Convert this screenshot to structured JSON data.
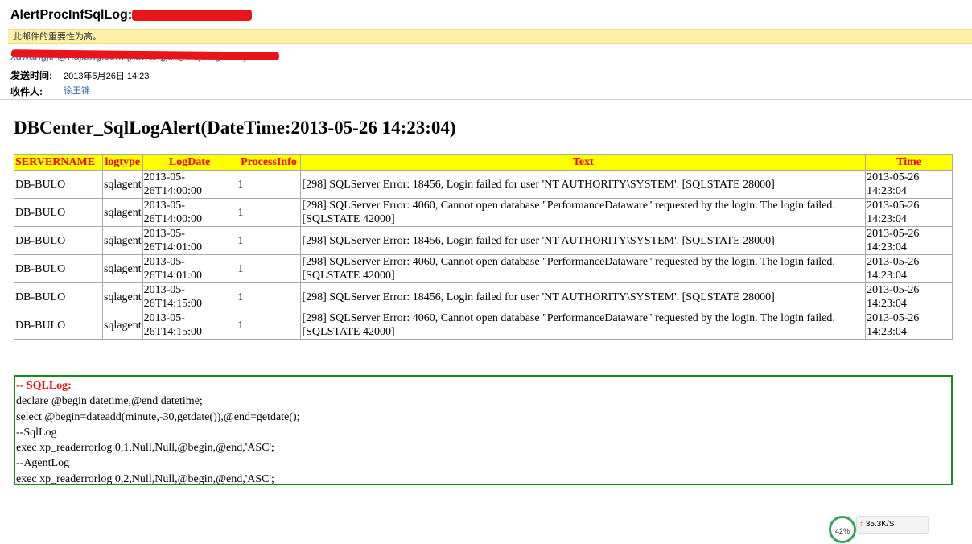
{
  "email": {
    "subject": "AlertProcInfSqlLog:",
    "importance_note": "此邮件的重要性为高。",
    "sender": "xuwangjin@hujiang.com [xuwangjin@hujiang.com]",
    "sent_label": "发送时间:",
    "sent_value": "2013年5月26日  14:23",
    "to_label": "收件人:",
    "to_value": "徐王锦"
  },
  "report": {
    "heading": "DBCenter_SqlLogAlert(DateTime:2013-05-26 14:23:04)",
    "columns": [
      "SERVERNAME",
      "logtype",
      "LogDate",
      "ProcessInfo",
      "Text",
      "Time"
    ],
    "rows": [
      [
        "DB-BULO",
        "sqlagent",
        "2013-05-26T14:00:00",
        "1",
        "[298] SQLServer Error: 18456, Login failed for user 'NT AUTHORITY\\SYSTEM'. [SQLSTATE 28000]",
        "2013-05-26 14:23:04"
      ],
      [
        "DB-BULO",
        "sqlagent",
        "2013-05-26T14:00:00",
        "1",
        "[298] SQLServer Error: 4060, Cannot open database \"PerformanceDataware\" requested by the login. The login failed. [SQLSTATE 42000]",
        "2013-05-26 14:23:04"
      ],
      [
        "DB-BULO",
        "sqlagent",
        "2013-05-26T14:01:00",
        "1",
        "[298] SQLServer Error: 18456, Login failed for user 'NT AUTHORITY\\SYSTEM'. [SQLSTATE 28000]",
        "2013-05-26 14:23:04"
      ],
      [
        "DB-BULO",
        "sqlagent",
        "2013-05-26T14:01:00",
        "1",
        "[298] SQLServer Error: 4060, Cannot open database \"PerformanceDataware\" requested by the login. The login failed. [SQLSTATE 42000]",
        "2013-05-26 14:23:04"
      ],
      [
        "DB-BULO",
        "sqlagent",
        "2013-05-26T14:15:00",
        "1",
        "[298] SQLServer Error: 18456, Login failed for user 'NT AUTHORITY\\SYSTEM'. [SQLSTATE 28000]",
        "2013-05-26 14:23:04"
      ],
      [
        "DB-BULO",
        "sqlagent",
        "2013-05-26T14:15:00",
        "1",
        "[298] SQLServer Error: 4060, Cannot open database \"PerformanceDataware\" requested by the login. The login failed. [SQLSTATE 42000]",
        "2013-05-26 14:23:04"
      ]
    ]
  },
  "sql": {
    "title": "-- SQLLog:",
    "lines": [
      "declare @begin datetime,@end datetime;",
      "select @begin=dateadd(minute,-30,getdate()),@end=getdate();",
      "--SqlLog",
      "exec xp_readerrorlog 0,1,Null,Null,@begin,@end,'ASC';",
      "--AgentLog",
      "exec xp_readerrorlog 0,2,Null,Null,@begin,@end,'ASC';"
    ]
  },
  "widget": {
    "percent": "42%",
    "speed": "35.3K/S",
    "arrow_icon": "up-arrow-icon"
  },
  "colors": {
    "header_bg": "#ffff00",
    "header_text": "#ff0000",
    "table_border": "#2b8a2b",
    "importance_bg": "#fdf0a8"
  }
}
